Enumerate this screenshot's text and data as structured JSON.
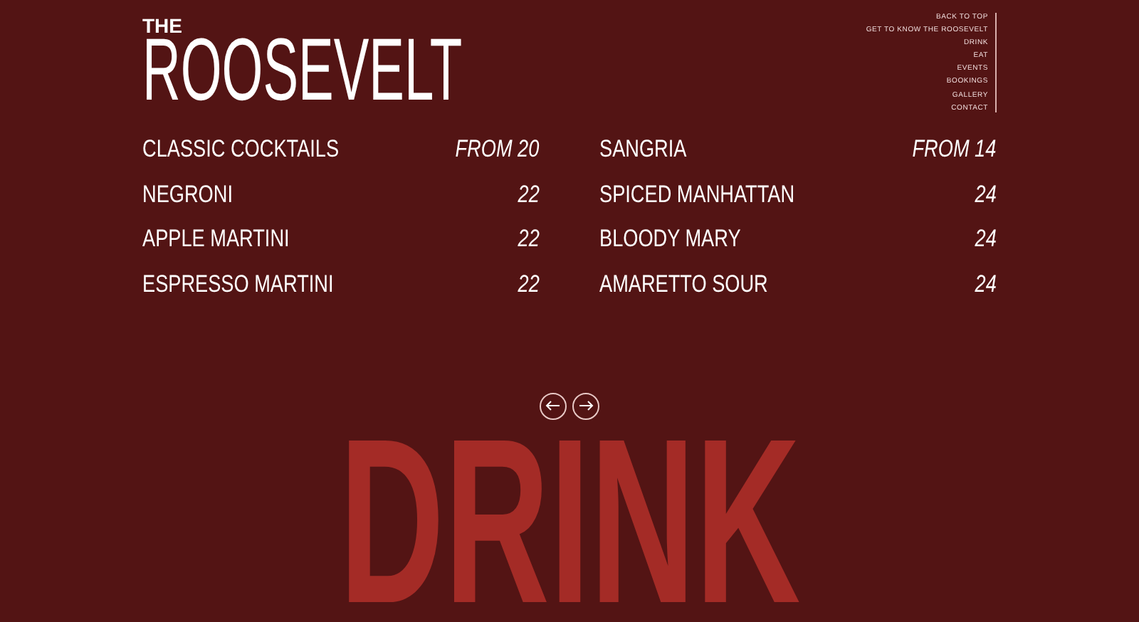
{
  "brand": {
    "prefix": "THE",
    "name": "ROOSEVELT"
  },
  "nav": [
    "BACK TO TOP",
    "GET TO KNOW THE ROOSEVELT",
    "DRINK",
    "EAT",
    "EVENTS",
    "BOOKINGS",
    "GALLERY",
    "CONTACT"
  ],
  "menu_columns": [
    [
      {
        "name": "CLASSIC COCKTAILS",
        "price": "FROM 20"
      },
      {
        "name": "NEGRONI",
        "price": "22"
      },
      {
        "name": "APPLE MARTINI",
        "price": "22"
      },
      {
        "name": "ESPRESSO MARTINI",
        "price": "22"
      }
    ],
    [
      {
        "name": "SANGRIA",
        "price": "FROM 14"
      },
      {
        "name": "SPICED MANHATTAN",
        "price": "24"
      },
      {
        "name": "BLOODY MARY",
        "price": "24"
      },
      {
        "name": "AMARETTO SOUR",
        "price": "24"
      }
    ]
  ],
  "section_title": "DRINK"
}
